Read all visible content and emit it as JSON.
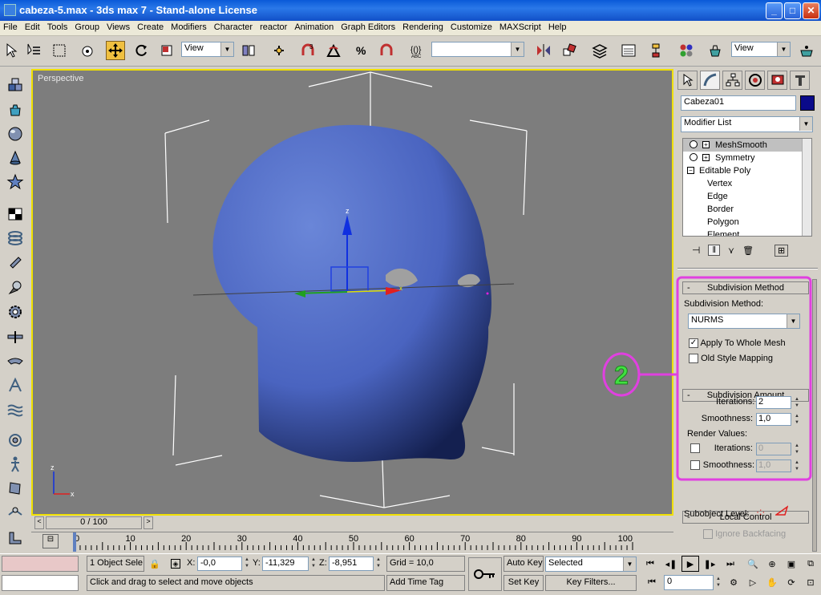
{
  "window": {
    "title": "cabeza-5.max - 3ds max 7 - Stand-alone License",
    "minimize": "_",
    "maximize": "□",
    "close": "✕"
  },
  "menu": [
    "File",
    "Edit",
    "Tools",
    "Group",
    "Views",
    "Create",
    "Modifiers",
    "Character",
    "reactor",
    "Animation",
    "Graph Editors",
    "Rendering",
    "Customize",
    "MAXScript",
    "Help"
  ],
  "toolbar": {
    "ref_coord": "View",
    "named_selection": "",
    "render_view": "View"
  },
  "viewport": {
    "label": "Perspective",
    "axis_z": "z",
    "axis_x": "x"
  },
  "command_panel": {
    "object_name": "Cabeza01",
    "object_color": "#0a0a8a",
    "modifier_list": "Modifier List",
    "stack": [
      {
        "label": "MeshSmooth",
        "selected": true
      },
      {
        "label": "Symmetry",
        "selected": false
      },
      {
        "label": "Editable Poly",
        "selected": false
      },
      {
        "label": "Vertex",
        "selected": false
      },
      {
        "label": "Edge",
        "selected": false
      },
      {
        "label": "Border",
        "selected": false
      },
      {
        "label": "Polygon",
        "selected": false
      },
      {
        "label": "Element",
        "selected": false
      }
    ],
    "subdiv_method": {
      "header": "Subdivision Method",
      "label": "Subdivision Method:",
      "value": "NURMS",
      "apply_whole_mesh": "Apply To Whole Mesh",
      "apply_whole_mesh_checked": true,
      "old_style": "Old Style Mapping",
      "old_style_checked": false
    },
    "subdiv_amount": {
      "header": "Subdivision Amount",
      "iterations_label": "Iterations:",
      "iterations": "2",
      "smoothness_label": "Smoothness:",
      "smoothness": "1,0",
      "render_values": "Render Values:",
      "r_iterations_label": "Iterations:",
      "r_iterations": "0",
      "r_smoothness_label": "Smoothness:",
      "r_smoothness": "1,0"
    },
    "local_control": {
      "header": "Local Control",
      "subobject_level": "Subobject Level:",
      "ignore_backfacing": "Ignore Backfacing"
    },
    "callout": "2",
    "callout_color": "#e040e0"
  },
  "timeline": {
    "frame": "0 / 100",
    "ticks": [
      "0",
      "10",
      "20",
      "30",
      "40",
      "50",
      "60",
      "70",
      "80",
      "90",
      "100"
    ]
  },
  "status": {
    "selection": "1 Object Sele",
    "x_label": "X:",
    "x": "-0,0",
    "y_label": "Y:",
    "y": "-11,329",
    "z_label": "Z:",
    "z": "-8,951",
    "grid": "Grid = 10,0",
    "prompt": "Click and drag to select and move objects",
    "add_time_tag": "Add Time Tag",
    "auto_key": "Auto Key",
    "set_key": "Set Key",
    "selected": "Selected",
    "key_filters": "Key Filters...",
    "frame_field": "0"
  }
}
